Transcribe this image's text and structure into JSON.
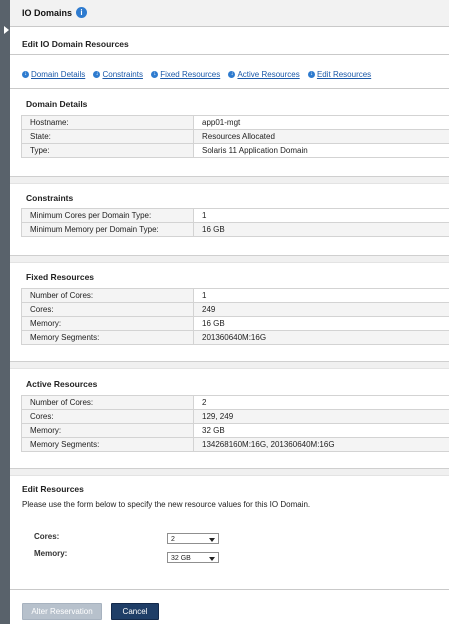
{
  "header": {
    "title": "IO Domains",
    "info_glyph": "i"
  },
  "page_title": "Edit IO Domain Resources",
  "nav": {
    "links": [
      "Domain Details",
      "Constraints",
      "Fixed Resources",
      "Active Resources",
      "Edit Resources"
    ],
    "icon": "down-arrow-circle-icon"
  },
  "domain_details": {
    "title": "Domain Details",
    "rows": [
      {
        "label": "Hostname:",
        "value": "app01-mgt"
      },
      {
        "label": "State:",
        "value": "Resources Allocated"
      },
      {
        "label": "Type:",
        "value": "Solaris 11 Application Domain"
      }
    ]
  },
  "constraints": {
    "title": "Constraints",
    "rows": [
      {
        "label": "Minimum Cores per Domain Type:",
        "value": "1"
      },
      {
        "label": "Minimum Memory per Domain Type:",
        "value": "16 GB"
      }
    ]
  },
  "fixed_resources": {
    "title": "Fixed Resources",
    "rows": [
      {
        "label": "Number of Cores:",
        "value": "1"
      },
      {
        "label": "Cores:",
        "value": "249"
      },
      {
        "label": "Memory:",
        "value": "16 GB"
      },
      {
        "label": "Memory Segments:",
        "value": "201360640M:16G"
      }
    ]
  },
  "active_resources": {
    "title": "Active Resources",
    "rows": [
      {
        "label": "Number of Cores:",
        "value": "2"
      },
      {
        "label": "Cores:",
        "value": "129, 249"
      },
      {
        "label": "Memory:",
        "value": "32 GB"
      },
      {
        "label": "Memory Segments:",
        "value": "134268160M:16G, 201360640M:16G"
      }
    ]
  },
  "edit_resources": {
    "title": "Edit Resources",
    "description": "Please use the form below to specify the new resource values for this IO Domain.",
    "cores_label": "Cores:",
    "cores_value": "2",
    "memory_label": "Memory:",
    "memory_value": "32 GB"
  },
  "buttons": {
    "alter": "Alter Reservation",
    "cancel": "Cancel"
  },
  "colors": {
    "rail": "#59626b",
    "link": "#1a58a8",
    "primary_button": "#1f3e67",
    "disabled_button": "#b7c1cc"
  }
}
